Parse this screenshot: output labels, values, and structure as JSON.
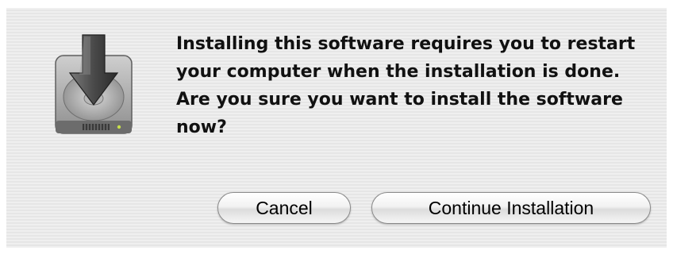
{
  "dialog": {
    "message": "Installing this software requires you to restart your computer when the installation is done. Are you sure you want to install the software now?",
    "icon": "installer-disk-icon",
    "buttons": {
      "cancel_label": "Cancel",
      "continue_label": "Continue Installation"
    }
  },
  "colors": {
    "dialog_background": "#ececec",
    "text": "#111111",
    "button_border": "#8a8a8a",
    "status_led": "#c8e04a"
  }
}
